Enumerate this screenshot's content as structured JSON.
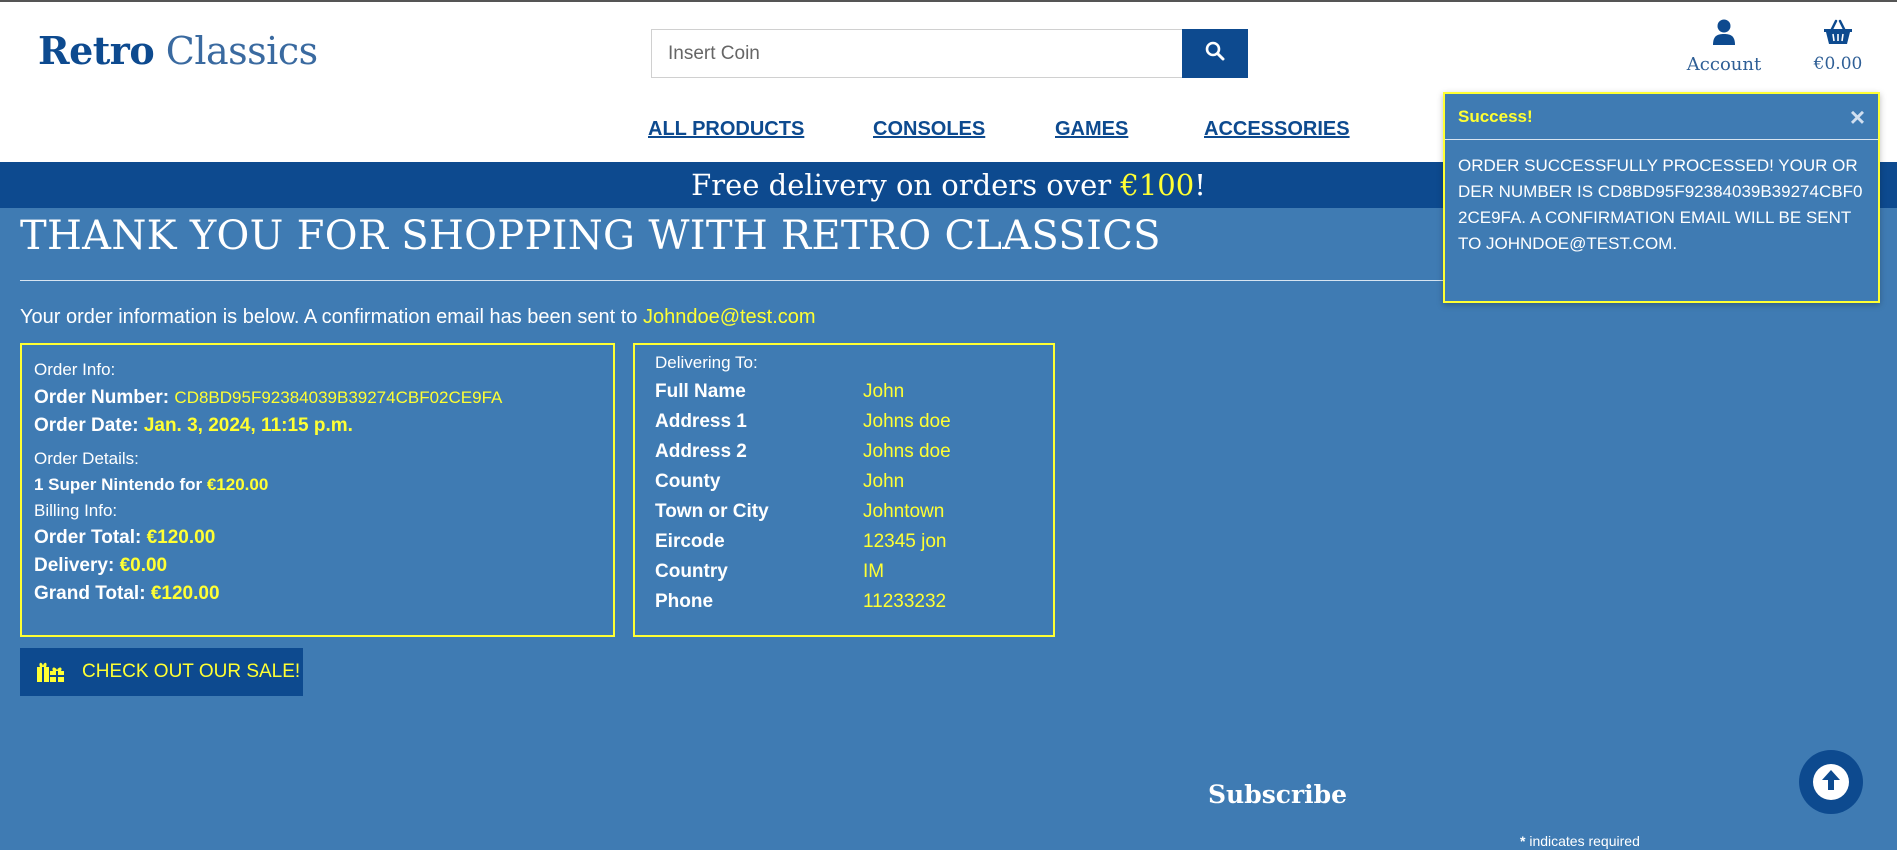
{
  "header": {
    "logo_part1": "Retro",
    "logo_part2": "Classics",
    "search_placeholder": "Insert Coin",
    "account_label": "Account",
    "cart_total": "€0.00"
  },
  "nav": {
    "items": [
      {
        "label": "ALL PRODUCTS"
      },
      {
        "label": "CONSOLES"
      },
      {
        "label": "GAMES"
      },
      {
        "label": "ACCESSORIES"
      }
    ]
  },
  "banner": {
    "text": "Free delivery on orders over ",
    "amount": "€100",
    "suffix": "!"
  },
  "page": {
    "title": "THANK YOU FOR SHOPPING WITH RETRO CLASSICS",
    "intro": "Your order information is below. A confirmation email has been sent to ",
    "email": "Johndoe@test.com"
  },
  "order": {
    "info_label": "Order Info:",
    "number_label": "Order Number:",
    "number_value": "CD8BD95F92384039B39274CBF02CE9FA",
    "date_label": "Order Date:",
    "date_value": "Jan. 3, 2024, 11:15 p.m.",
    "details_label": "Order Details:",
    "item_text": "1 Super Nintendo for ",
    "item_price": "€120.00",
    "billing_label": "Billing Info:",
    "total_label": "Order Total:",
    "total_value": "€120.00",
    "delivery_label": "Delivery:",
    "delivery_value": "€0.00",
    "grand_label": "Grand Total:",
    "grand_value": "€120.00"
  },
  "delivery": {
    "heading": "Delivering To:",
    "rows": [
      {
        "key": "Full Name",
        "value": "John"
      },
      {
        "key": "Address 1",
        "value": "Johns doe"
      },
      {
        "key": "Address 2",
        "value": "Johns doe"
      },
      {
        "key": "County",
        "value": "John"
      },
      {
        "key": "Town or City",
        "value": "Johntown"
      },
      {
        "key": "Eircode",
        "value": "12345 jon"
      },
      {
        "key": "Country",
        "value": "IM"
      },
      {
        "key": "Phone",
        "value": "11233232"
      }
    ]
  },
  "sale_button": "CHECK OUT OUR SALE!",
  "footer": {
    "subscribe": "Subscribe",
    "required_star": "*",
    "required_note": " indicates required"
  },
  "toast": {
    "title": "Success!",
    "close": "×",
    "message": "ORDER SUCCESSFULLY PROCESSED! YOUR ORDER NUMBER IS CD8BD95F92384039B39274CBF02CE9FA. A CONFIRMATION EMAIL WILL BE SENT TO JOHNDOE@TEST.COM."
  },
  "colors": {
    "brand": "#0d4a8f",
    "background": "#3f7bb3",
    "highlight": "#ffff33"
  }
}
